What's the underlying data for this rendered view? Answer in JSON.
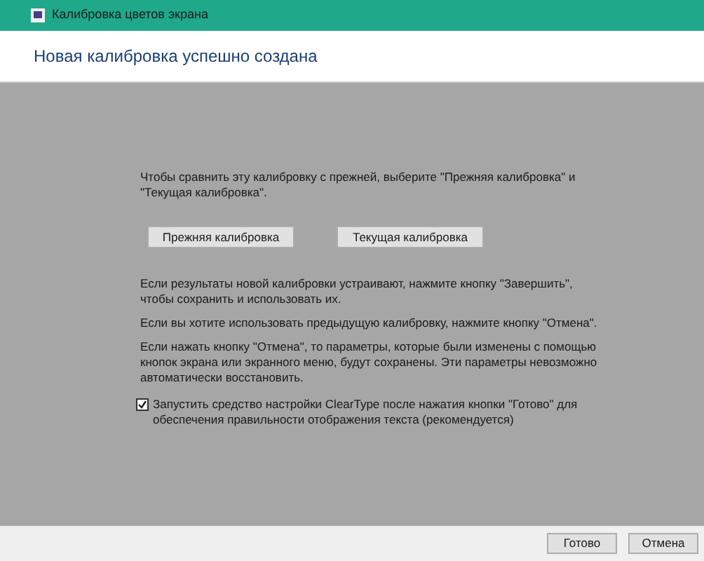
{
  "window": {
    "title": "Калибровка цветов экрана"
  },
  "heading": "Новая калибровка успешно создана",
  "compare_text": "Чтобы сравнить эту калибровку с прежней, выберите \"Прежняя калибровка\" и \"Текущая калибровка\".",
  "compare_buttons": [
    {
      "label": "Прежняя калибровка"
    },
    {
      "label": "Текущая калибровка"
    }
  ],
  "paragraphs": [
    "Если результаты новой калибровки устраивают, нажмите кнопку \"Завершить\", чтобы сохранить и использовать их.",
    "Если вы хотите использовать предыдущую калибровку, нажмите кнопку \"Отмена\".",
    "Если нажать кнопку \"Отмена\", то параметры, которые были изменены с помощью кнопок экрана или экранного меню, будут сохранены. Эти параметры невозможно автоматически восстановить."
  ],
  "cleartype_option": {
    "label": "Запустить средство настройки ClearType после нажатия кнопки \"Готово\" для обеспечения правильности отображения текста (рекомендуется)",
    "checked": true
  },
  "footer_buttons": [
    {
      "label": "Готово"
    },
    {
      "label": "Отмена"
    }
  ]
}
